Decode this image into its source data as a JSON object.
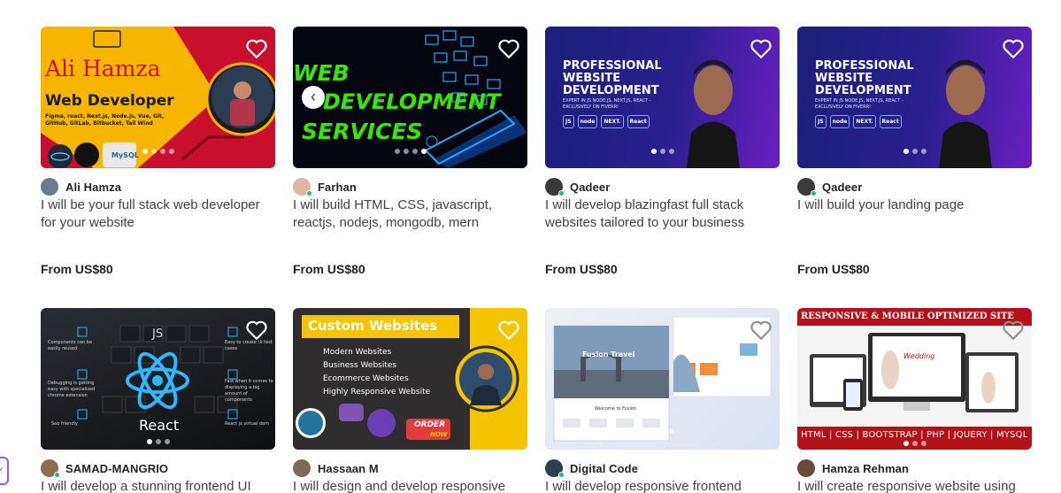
{
  "gigs": [
    {
      "seller": "Ali Hamza",
      "title": "I will be your full stack web developer for your website",
      "price": "From US$80",
      "thumb": {
        "line1": "Ali Hamza",
        "line2": "Web Developer",
        "tags": "Figma, react, Next.js, Node.js, Vue, Git, GitHub, GitLab, Bitbucket, Tail Wind",
        "badge": "MySQL"
      }
    },
    {
      "seller": "Farhan",
      "title": "I will build HTML, CSS, javascript, reactjs, nodejs, mongodb, mern website",
      "price": "From US$80",
      "thumb": {
        "line1": "WEB",
        "line2": "DEVELOPMENT",
        "line3": "SERVICES"
      }
    },
    {
      "seller": "Qadeer",
      "title": "I will develop blazingfast full stack websites tailored to your business",
      "price": "From US$80",
      "thumb": {
        "line1": "PROFESSIONAL",
        "line2": "WEBSITE",
        "line3": "DEVELOPMENT",
        "sub": "EXPERT IN JS NODE.JS, NEXT.JS, REACT - EXCLUSIVELY ON FIVERR!",
        "chips": [
          "JS",
          "node",
          "NEXT.",
          "React"
        ]
      }
    },
    {
      "seller": "Qadeer",
      "title": "I will build your landing page",
      "price": "From US$80",
      "thumb": {
        "line1": "PROFESSIONAL",
        "line2": "WEBSITE",
        "line3": "DEVELOPMENT",
        "sub": "EXPERT IN JS NODE.JS, NEXT.JS, REACT - EXCLUSIVELY ON FIVERR!",
        "chips": [
          "JS",
          "node",
          "NEXT.",
          "React"
        ]
      }
    },
    {
      "seller": "SAMAD-MANGRIO",
      "title": "I will develop a stunning frontend UI",
      "thumb": {
        "top": "JS",
        "bottom": "React",
        "left": [
          "Components can be easily reused",
          "Debugging is getting easy with specialized chrome extension",
          "Seo friendly"
        ],
        "right": [
          "Easy to create UI test cases",
          "Fast when it comes to displaying a big amount of components",
          "React js virtual dom"
        ]
      }
    },
    {
      "seller": "Hassaan M",
      "title": "I will design and develop responsive",
      "thumb": {
        "banner": "Custom Websites",
        "items": [
          "Modern Websites",
          "Business Websites",
          "Ecommerce Websites",
          "Highly Responsive Website"
        ],
        "cta1": "ORDER",
        "cta2": "NOW"
      }
    },
    {
      "seller": "Digital Code",
      "title": "I will develop responsive frontend",
      "thumb": {
        "hero": "Fusion Travel",
        "welcome": "Welcome to Fusion"
      }
    },
    {
      "seller": "Hamza Rehman",
      "title": "I will create responsive website using",
      "thumb": {
        "banner": "RESPONSIVE & MOBILE OPTIMIZED SITE",
        "footer": "HTML | CSS | BOOTSTRAP | PHP | JQUERY | MYSQL",
        "screen": "Wedding"
      }
    }
  ],
  "colors": {
    "heart_stroke": "#ffffff",
    "online": "#1dbf73",
    "price": "#222325"
  }
}
